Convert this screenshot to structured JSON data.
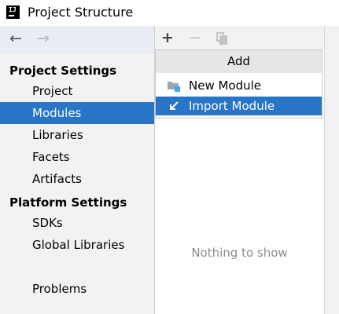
{
  "window": {
    "title": "Project Structure"
  },
  "navigation": {
    "back_icon": "arrow-left-icon",
    "forward_icon": "arrow-right-icon"
  },
  "sidebar": {
    "project_settings_header": "Project Settings",
    "project_settings_items": [
      {
        "label": "Project",
        "selected": false
      },
      {
        "label": "Modules",
        "selected": true
      },
      {
        "label": "Libraries",
        "selected": false
      },
      {
        "label": "Facets",
        "selected": false
      },
      {
        "label": "Artifacts",
        "selected": false
      }
    ],
    "platform_settings_header": "Platform Settings",
    "platform_settings_items": [
      {
        "label": "SDKs"
      },
      {
        "label": "Global Libraries"
      }
    ],
    "problems_label": "Problems"
  },
  "toolbar": {
    "add_symbol": "+",
    "remove_symbol": "−"
  },
  "add_popup": {
    "header": "Add",
    "items": [
      {
        "label": "New Module",
        "icon": "module-folder-icon",
        "selected": false
      },
      {
        "label": "Import Module",
        "icon": "import-arrow-icon",
        "selected": true
      }
    ]
  },
  "main": {
    "empty_text": "Nothing to show"
  },
  "colors": {
    "selection": "#2874c7",
    "accent_icon": "#3fa9f5"
  }
}
